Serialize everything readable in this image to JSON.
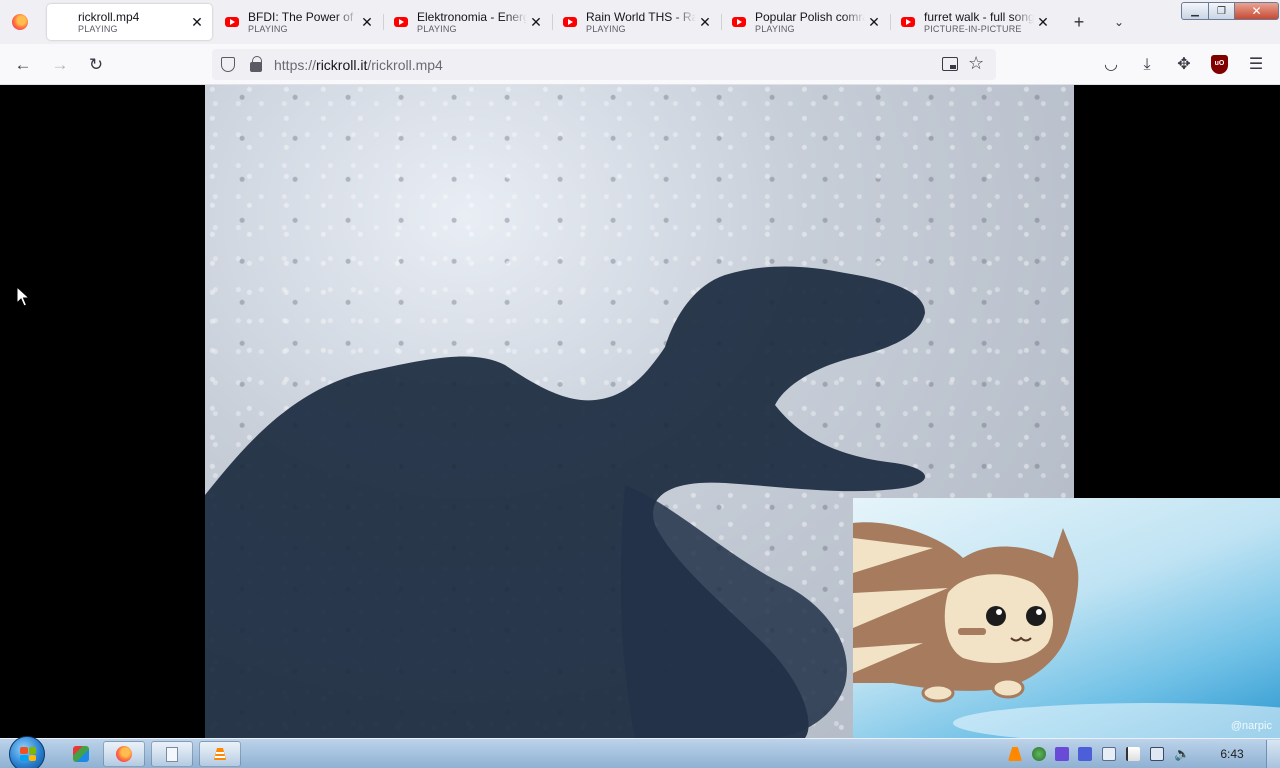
{
  "browser": {
    "tabs": [
      {
        "title": "rickroll.mp4",
        "status": "PLAYING",
        "favicon": "none-icon",
        "active": true
      },
      {
        "title": "BFDI: The Power of Two",
        "status": "PLAYING",
        "favicon": "youtube-icon",
        "active": false
      },
      {
        "title": "Elektronomia - Energy",
        "status": "PLAYING",
        "favicon": "youtube-icon",
        "active": false
      },
      {
        "title": "Rain World THS - Rain",
        "status": "PLAYING",
        "favicon": "youtube-icon",
        "active": false
      },
      {
        "title": "Popular Polish comrade",
        "status": "PLAYING",
        "favicon": "youtube-icon",
        "active": false
      },
      {
        "title": "furret walk - full song",
        "status": "PICTURE-IN-PICTURE",
        "favicon": "youtube-icon",
        "active": false
      }
    ],
    "tab_close_glyph": "✕",
    "new_tab_glyph": "+",
    "list_all_tabs_glyph": "⌄",
    "url": {
      "prefix": "https://",
      "host": "rickroll.it",
      "path": "/rickroll.mp4"
    },
    "window_controls": {
      "minimize": "▁",
      "maximize": "❐",
      "close": "✕"
    }
  },
  "pip": {
    "watermark": "@narpic"
  },
  "taskbar": {
    "clock": "6:43"
  },
  "colors": {
    "youtube_red": "#ff0000",
    "tab_strip_bg": "#f0f0f4",
    "taskbar_top": "#bcd3ea",
    "ublock": "#800000"
  }
}
